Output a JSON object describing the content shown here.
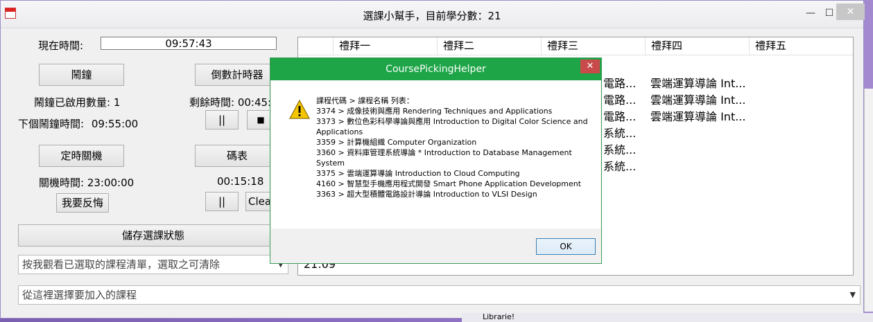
{
  "window": {
    "title": "選課小幫手，目前學分數：21",
    "min_glyph": "—",
    "max_glyph": "☐",
    "close_glyph": "✕"
  },
  "clock": {
    "label": "現在時間:",
    "value": "09:57:43"
  },
  "alarm": {
    "button": "鬧鐘",
    "enabled_count_label": "鬧鐘已啟用數量:",
    "enabled_count": "1",
    "next_label": "下個鬧鐘時間:",
    "next_value": "09:55:00"
  },
  "countdown": {
    "button": "倒數計時器",
    "remaining_label": "剩餘時間: 00:45:",
    "pause_label": "||",
    "stop_label": "■"
  },
  "shutdown": {
    "button": "定時關機",
    "time_label": "關機時間: 23:00:00",
    "cancel_button": "我要反悔"
  },
  "stopwatch": {
    "button": "碼表",
    "value": "00:15:18",
    "pause_label": "||",
    "clear_label": "Clea"
  },
  "save_button": "儲存選課狀態",
  "selected_combo": "按我觀看已選取的課程清單，選取之可清除",
  "add_combo": "從這裡選擇要加入的課程",
  "grid": {
    "headers": [
      "禮拜一",
      "禮拜二",
      "禮拜三",
      "禮拜四",
      "禮拜五"
    ],
    "rows": [
      [
        "",
        "",
        "電路...",
        "雲端運算導論  Int...",
        ""
      ],
      [
        "",
        "",
        "電路...",
        "雲端運算導論  Int...",
        ""
      ],
      [
        "",
        "",
        "電路...",
        "雲端運算導論  Int...",
        ""
      ],
      [
        "",
        "",
        "系統...",
        "",
        ""
      ],
      [
        "",
        "",
        "系統...",
        "",
        ""
      ],
      [
        "",
        "",
        "系統...",
        "",
        ""
      ]
    ],
    "bottom_partial": "21:09"
  },
  "background": {
    "taskbar_text": "Librarie!"
  },
  "dialog": {
    "title": "CoursePickingHelper",
    "close_glyph": "✕",
    "icon": "warning-icon",
    "lines": [
      "課程代碼 > 課程名稱 列表：",
      "3374 > 成像技術與應用  Rendering Techniques and Applications",
      "3373 > 數位色彩科學導論與應用  Introduction to Digital Color Science and Applications",
      "3359 > 計算機組織  Computer Organization",
      "3360 > 資料庫管理系統導論 * Introduction to Database Management System",
      "3375 > 雲端運算導論  Introduction to Cloud Computing",
      "4160 > 智慧型手機應用程式開發  Smart Phone Application Development",
      "3363 > 超大型積體電路設計導論  Introduction to VLSI Design"
    ],
    "ok": "OK"
  }
}
